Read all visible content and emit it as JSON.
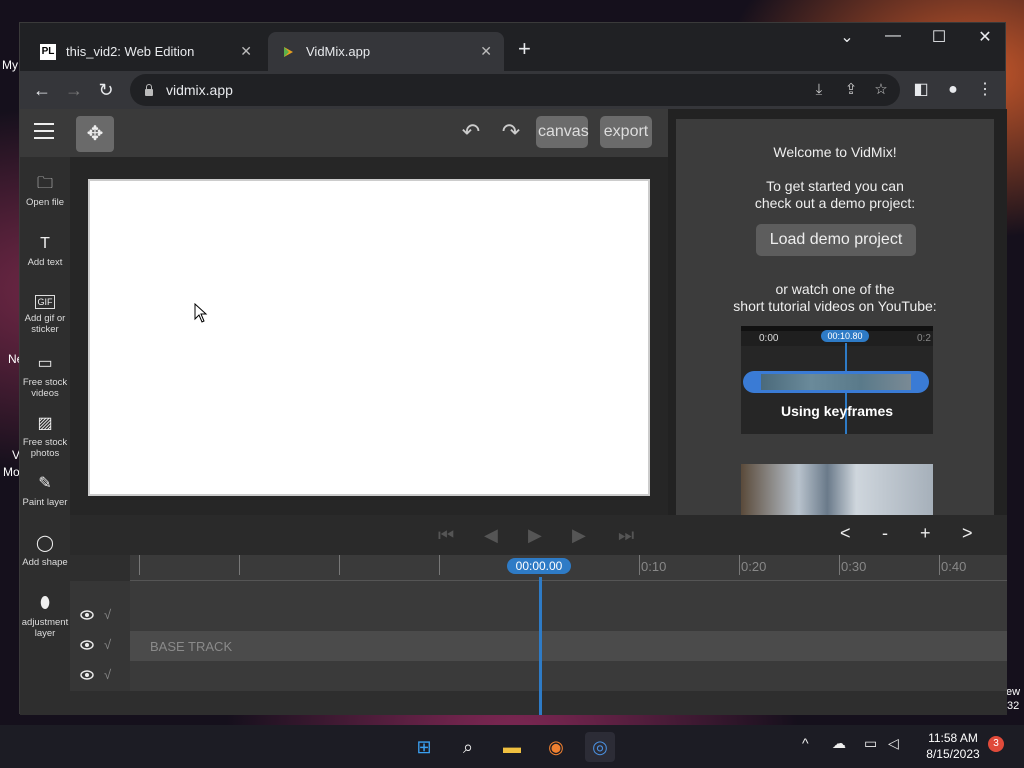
{
  "desktop": {
    "labels": [
      "My",
      "Ne",
      "V",
      "Mo",
      "ew",
      "32"
    ]
  },
  "browser": {
    "tabs": [
      {
        "title": "this_vid2: Web Edition",
        "favicon": "PL"
      },
      {
        "title": "VidMix.app",
        "favicon": "vidmix-logo"
      }
    ],
    "url": "vidmix.app",
    "window_controls": {
      "dropdown": "⌄",
      "minimize": "—",
      "maximize": "☐",
      "close": "✕"
    }
  },
  "app": {
    "toolbar": {
      "canvas_label": "canvas",
      "export_label": "export"
    },
    "sidebar": [
      {
        "icon": "folder-icon",
        "label": "Open file"
      },
      {
        "icon": "text-icon",
        "label": "Add text"
      },
      {
        "icon": "gif-icon",
        "label": "Add gif or sticker"
      },
      {
        "icon": "video-icon",
        "label": "Free stock videos"
      },
      {
        "icon": "photo-icon",
        "label": "Free stock photos"
      },
      {
        "icon": "brush-icon",
        "label": "Paint layer"
      },
      {
        "icon": "shape-icon",
        "label": "Add shape"
      },
      {
        "icon": "adjustment-icon",
        "label": "adjustment layer"
      }
    ],
    "welcome": {
      "heading": "Welcome to VidMix!",
      "intro_line1": "To get started you can",
      "intro_line2": "check out a demo project:",
      "demo_button": "Load demo project",
      "or_line1": "or watch one of the",
      "or_line2": "short tutorial videos on YouTube:",
      "tutorial": {
        "title": "Using keyframes",
        "ruler_start": "0:00",
        "ruler_end": "0:2",
        "current_time": "00:10.80"
      }
    },
    "timeline": {
      "controls": {
        "skip_back": "⏮",
        "step_back": "◀",
        "play": "▶",
        "step_forward": "▶",
        "skip_forward": "⏭"
      },
      "zoom": {
        "prev": "<",
        "zoom_out": "-",
        "zoom_in": "+",
        "next": ">"
      },
      "playhead": "00:00.00",
      "tick_labels": [
        "0:10",
        "0:20",
        "0:30",
        "0:40"
      ],
      "tracks": [
        {
          "label": "",
          "type": "normal"
        },
        {
          "label": "BASE TRACK",
          "type": "base"
        },
        {
          "label": "",
          "type": "normal"
        }
      ]
    }
  },
  "taskbar": {
    "time": "11:58 AM",
    "date": "8/15/2023",
    "notifications": "3"
  }
}
